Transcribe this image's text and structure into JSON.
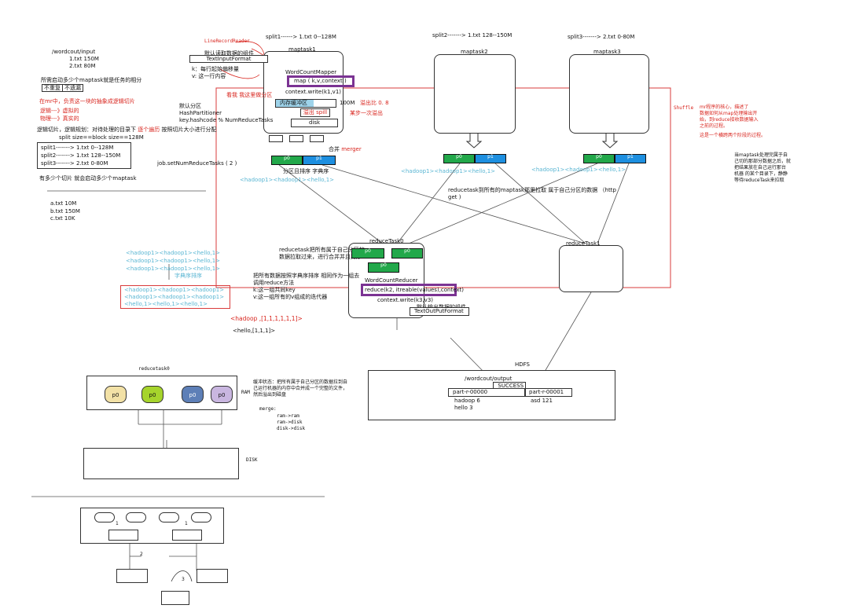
{
  "colors": {
    "green": "#22a84a",
    "blue": "#1d8fe0",
    "purple": "#7b3393",
    "red": "#d8241d",
    "cyan": "#5ab6d3"
  },
  "left": {
    "path": "/wordcout/input",
    "file1": "1.txt  150M",
    "file2": "2.txt  80M",
    "q": "所需启动多少个maptask就是任务的相分",
    "opt1": "不重复",
    "opt2": "不遗漏",
    "mr_note": "在mr中，负责这一块的抽象成逻辑切片",
    "logic": "逻辑---》虚拟的",
    "physical": "物理---》真实的",
    "slice_note": "逻辑切片，逻辑规划：对待处理的目录下",
    "slice_note_red": "逐个遍历",
    "slice_note2": "按照切片大小进行分配",
    "split_size": "split size==block size==128M",
    "splits": [
      "split1-------> 1.txt  0--128M",
      "split2-------> 1.txt  128--150M",
      "split3-------> 2.txt  0-80M"
    ],
    "how_many": "有多少个切片  就会启动多少个maptask",
    "files2": [
      "a.txt  10M",
      "b.txt  150M",
      "c.txt  10K"
    ]
  },
  "map1": {
    "line_record_reader": "LineRecordReader",
    "split": "split1------> 1.txt  0--128M",
    "title": "maptask1",
    "default_comp": "默认读取数据的组件",
    "input_format": "TextInputFormat",
    "k_note": "k：每行起始偏移量",
    "v_note": "v: 这一行内容",
    "mapper": "WordCountMapper",
    "map_call": "map ( k,v,context )",
    "context_write": "context.write(k1,v1)",
    "partition_red": "看我 我这里做分区",
    "buffer": "内存缓冲区",
    "buffer_size": "100M",
    "spill_ratio": "溢出比 0. 8",
    "spill": "溢出 spill",
    "spill_step": "某步一次溢出",
    "disk": "disk",
    "default_partition": "默认分区",
    "hash_partitioner": "HashPartitioner",
    "hash_code": "key.hashcode  %  NumReduceTasks",
    "set_num": "job.setNumReduceTasks ( 2 )",
    "merge": "合并",
    "merger": "merger",
    "sort_note": "分区且排序  字典序",
    "kv_out": "<hadoop1><hadoop1><hello,1>",
    "seg_left": "p0",
    "seg_right": "p1"
  },
  "map2": {
    "split": "split2-------> 1.txt  128--150M",
    "title": "maptask2",
    "kv_out": "<hadoop1><hadoop1><hello,1>",
    "seg_left": "p0",
    "seg_right": "p1"
  },
  "map3": {
    "split": "split3-------> 2.txt  0-80M",
    "title": "maptask3",
    "kv_out": "<hadoop1><hadoop1><hello,1>",
    "seg_left": "p0",
    "seg_right": "p1"
  },
  "shuffle": {
    "label": "Shuffle",
    "desc": [
      "mr程序的核心，描述了",
      "数据如何从map处理输出开",
      "始，到reduce接收数据输入",
      "之前的过程。"
    ],
    "note": "这是一个横跨两个阶段的过程。",
    "right_note": [
      "当maptask处理完属于自",
      "己切的那部分数据之后，就",
      "把结果放在自己运行那台",
      "机器 的某个目录下，静静",
      "等待reduceTask来拉取"
    ]
  },
  "reduce": {
    "fetch_note": "reducetask到所有的maptask那里拉取 属于自己分区的数据   （http",
    "fetch_note2": "get )",
    "title0": "reduceTask0",
    "title1": "reduceTask1",
    "pull_note": "reducetask把所有属于自己分区的",
    "pull_note2": "数据拉取过来，进行合并并且排序",
    "group_note": "把所有数据按照字典序排序 相同作为一组去",
    "group_note2": "调用reduce方法",
    "k_note": "k:这一组共同key",
    "v_note": "v:这一组所有的v组成的迭代器",
    "reducer": "WordCountReducer",
    "reduce_call": "reduce(k2, itreable(values),context)",
    "context_write": "context.write(k3,v3)",
    "default_out": "默认输出数据的组件",
    "output_format": "TextOutPutFormat",
    "p0a": "p0",
    "p0b": "p0",
    "p0c": "p0"
  },
  "left_kv": {
    "rows": [
      "<hadoop1><hadoop1><hello,1>",
      "<hadoop1><hadoop1><hello,1>",
      "<hadoop1><hadoop1><hello,1>"
    ],
    "sort": "字典序排序",
    "sorted": [
      "<hadoop1><hadoop1><hadoop1>",
      "<hadoop1><hadoop1><hadoop1>",
      "<hello,1><hello,1><hello,1>"
    ],
    "hadoop_group": "<hadoop ,[1,1,1,1,1,1]>",
    "hello_group": "<hello,[1,1,1]>"
  },
  "hdfs": {
    "label": "HDFS",
    "path": "/wordcout/output",
    "success": "_SUCCESS",
    "part0": "part-r-00000",
    "part1": "part-r-00001",
    "line1": "hadoop 6",
    "line2": "hello 3",
    "line3": "asd 121"
  },
  "bottom": {
    "reducetask": "reducetask0",
    "ram": "RAM",
    "disk": "DISK",
    "p": [
      "p0",
      "p0",
      "p0",
      "p0"
    ],
    "merge_note": [
      "缓冲状态：把所有属于自己分区的数据拉到自",
      "己运行机器的内存中合并成一个完整的文件，",
      "然后溢出到磁盘"
    ],
    "merge": "merge:",
    "merge_lines": [
      "ram->ram",
      "ram->disk",
      "disk->disk"
    ],
    "tree_labels": [
      "1",
      "1",
      "2",
      "3"
    ]
  }
}
